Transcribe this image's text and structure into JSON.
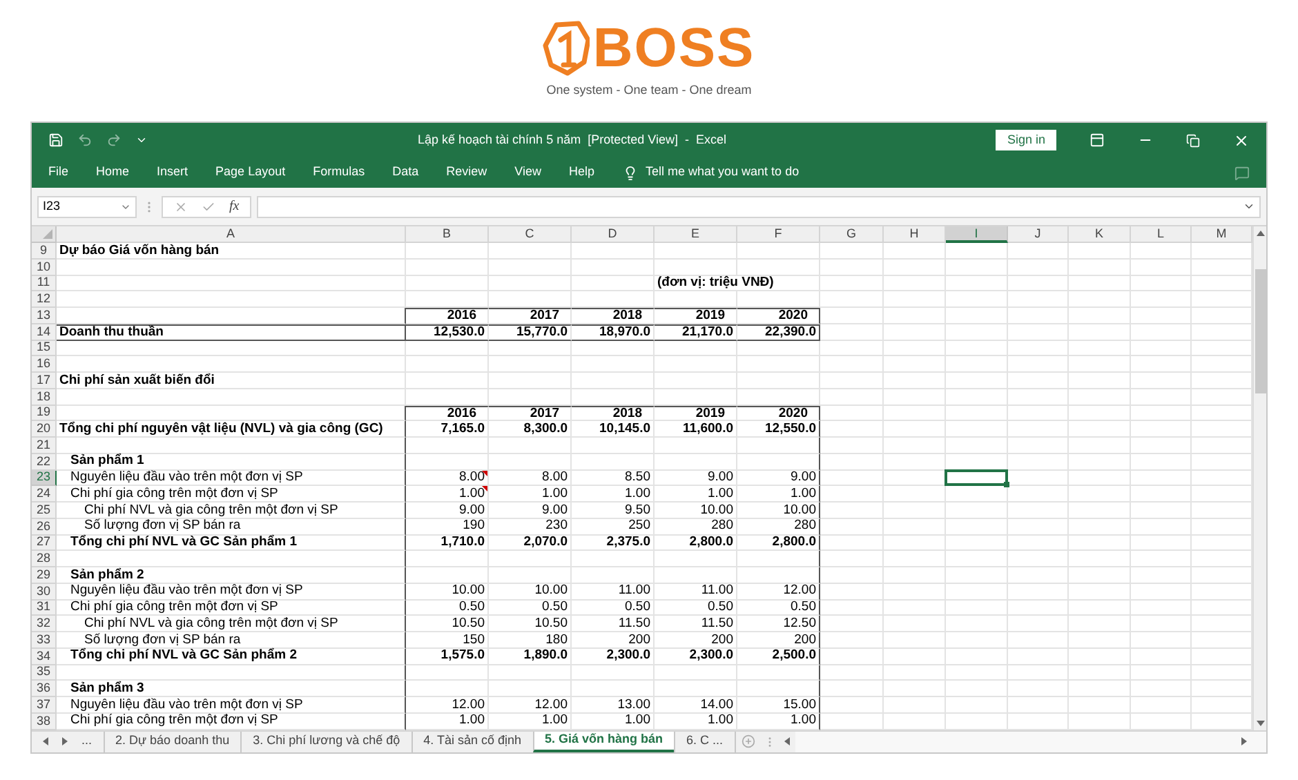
{
  "logo": {
    "brand": "BOSS",
    "tagline": "One system - One team - One dream"
  },
  "window": {
    "title": "Lập kế hoạch tài chính 5 năm  [Protected View]  -  Excel",
    "sign_in": "Sign in"
  },
  "ribbon_tabs": [
    "File",
    "Home",
    "Insert",
    "Page Layout",
    "Formulas",
    "Data",
    "Review",
    "View",
    "Help"
  ],
  "tell_me": "Tell me what you want to do",
  "formula_bar": {
    "name_box": "I23",
    "function_label": "fx"
  },
  "columns": [
    {
      "label": "A",
      "selected": false
    },
    {
      "label": "B",
      "selected": false
    },
    {
      "label": "C",
      "selected": false
    },
    {
      "label": "D",
      "selected": false
    },
    {
      "label": "E",
      "selected": false
    },
    {
      "label": "F",
      "selected": false
    },
    {
      "label": "G",
      "selected": false
    },
    {
      "label": "H",
      "selected": false
    },
    {
      "label": "I",
      "selected": true
    },
    {
      "label": "J",
      "selected": false
    },
    {
      "label": "K",
      "selected": false
    },
    {
      "label": "L",
      "selected": false
    },
    {
      "label": "M",
      "selected": false
    }
  ],
  "rows": [
    {
      "number": "9",
      "selected": false,
      "kind": "title",
      "boxed": false,
      "label": "Dự báo Giá vốn hàng bán"
    },
    {
      "number": "10",
      "selected": false,
      "kind": "blank",
      "boxed": false
    },
    {
      "number": "11",
      "selected": false,
      "kind": "note",
      "boxed": false,
      "note": "(đơn vị: triệu VNĐ)"
    },
    {
      "number": "12",
      "selected": false,
      "kind": "blank",
      "boxed": false
    },
    {
      "number": "13",
      "selected": false,
      "kind": "header",
      "boxed": true,
      "values": [
        "2016",
        "2017",
        "2018",
        "2019",
        "2020"
      ]
    },
    {
      "number": "14",
      "selected": false,
      "kind": "revenue",
      "boxed": true,
      "label": "Doanh thu thuần",
      "values": [
        "12,530.0",
        "15,770.0",
        "18,970.0",
        "21,170.0",
        "22,390.0"
      ]
    },
    {
      "number": "15",
      "selected": false,
      "kind": "blank",
      "boxed": false
    },
    {
      "number": "16",
      "selected": false,
      "kind": "blank",
      "boxed": false
    },
    {
      "number": "17",
      "selected": false,
      "kind": "title",
      "boxed": false,
      "label": "Chi phí sản xuất biến đổi"
    },
    {
      "number": "18",
      "selected": false,
      "kind": "blank",
      "boxed": false
    },
    {
      "number": "19",
      "selected": false,
      "kind": "header",
      "boxed": true,
      "values": [
        "2016",
        "2017",
        "2018",
        "2019",
        "2020"
      ]
    },
    {
      "number": "20",
      "selected": false,
      "kind": "total",
      "boxed": true,
      "label": "Tổng chi phí nguyên vật liệu (NVL) và gia công (GC)",
      "values": [
        "7,165.0",
        "8,300.0",
        "10,145.0",
        "11,600.0",
        "12,550.0"
      ]
    },
    {
      "number": "21",
      "selected": false,
      "kind": "blank",
      "boxed": true
    },
    {
      "number": "22",
      "selected": false,
      "kind": "section",
      "boxed": true,
      "label": "Sản phẩm 1"
    },
    {
      "number": "23",
      "selected": true,
      "kind": "item",
      "boxed": true,
      "comment": true,
      "label": "Nguyên liệu đầu vào trên một đơn vị SP",
      "values": [
        "8.00",
        "8.00",
        "8.50",
        "9.00",
        "9.00"
      ]
    },
    {
      "number": "24",
      "selected": false,
      "kind": "item",
      "boxed": true,
      "comment": true,
      "label": "Chi phí gia công trên một đơn vị SP",
      "values": [
        "1.00",
        "1.00",
        "1.00",
        "1.00",
        "1.00"
      ]
    },
    {
      "number": "25",
      "selected": false,
      "kind": "subitem",
      "boxed": true,
      "comment": false,
      "label": "Chi phí NVL và gia công trên một đơn vị SP",
      "values": [
        "9.00",
        "9.00",
        "9.50",
        "10.00",
        "10.00"
      ]
    },
    {
      "number": "26",
      "selected": false,
      "kind": "subitem",
      "boxed": true,
      "comment": false,
      "label": "Số lượng đơn vị SP bán ra",
      "values": [
        "190",
        "230",
        "250",
        "280",
        "280"
      ]
    },
    {
      "number": "27",
      "selected": false,
      "kind": "subtotal",
      "boxed": true,
      "label": "Tổng chi phí NVL và GC Sản phẩm 1",
      "values": [
        "1,710.0",
        "2,070.0",
        "2,375.0",
        "2,800.0",
        "2,800.0"
      ]
    },
    {
      "number": "28",
      "selected": false,
      "kind": "blank",
      "boxed": true
    },
    {
      "number": "29",
      "selected": false,
      "kind": "section",
      "boxed": true,
      "label": "Sản phẩm 2"
    },
    {
      "number": "30",
      "selected": false,
      "kind": "item",
      "boxed": true,
      "comment": false,
      "label": "Nguyên liệu đầu vào trên một đơn vị SP",
      "values": [
        "10.00",
        "10.00",
        "11.00",
        "11.00",
        "12.00"
      ]
    },
    {
      "number": "31",
      "selected": false,
      "kind": "item",
      "boxed": true,
      "comment": false,
      "label": "Chi phí gia công trên một đơn vị SP",
      "values": [
        "0.50",
        "0.50",
        "0.50",
        "0.50",
        "0.50"
      ]
    },
    {
      "number": "32",
      "selected": false,
      "kind": "subitem",
      "boxed": true,
      "comment": false,
      "label": "Chi phí NVL và gia công trên một đơn vị SP",
      "values": [
        "10.50",
        "10.50",
        "11.50",
        "11.50",
        "12.50"
      ]
    },
    {
      "number": "33",
      "selected": false,
      "kind": "subitem",
      "boxed": true,
      "comment": false,
      "label": "Số lượng đơn vị SP bán ra",
      "values": [
        "150",
        "180",
        "200",
        "200",
        "200"
      ]
    },
    {
      "number": "34",
      "selected": false,
      "kind": "subtotal",
      "boxed": true,
      "label": "Tổng chi phí NVL và GC Sản phẩm 2",
      "values": [
        "1,575.0",
        "1,890.0",
        "2,300.0",
        "2,300.0",
        "2,500.0"
      ]
    },
    {
      "number": "35",
      "selected": false,
      "kind": "blank",
      "boxed": true
    },
    {
      "number": "36",
      "selected": false,
      "kind": "section",
      "boxed": true,
      "label": "Sản phẩm 3"
    },
    {
      "number": "37",
      "selected": false,
      "kind": "item",
      "boxed": true,
      "comment": false,
      "label": "Nguyên liệu đầu vào trên một đơn vị SP",
      "values": [
        "12.00",
        "12.00",
        "13.00",
        "14.00",
        "15.00"
      ]
    },
    {
      "number": "38",
      "selected": false,
      "kind": "item",
      "boxed": true,
      "comment": false,
      "label": "Chi phí gia công trên một đơn vị SP",
      "values": [
        "1.00",
        "1.00",
        "1.00",
        "1.00",
        "1.00"
      ]
    }
  ],
  "sheet_nav": "...",
  "sheet_tabs": [
    {
      "label": "2. Dự báo doanh thu",
      "selected": false
    },
    {
      "label": "3. Chi phí lương và chế độ",
      "selected": false
    },
    {
      "label": "4. Tài sản cố định",
      "selected": false
    },
    {
      "label": "5. Giá vốn hàng bán",
      "selected": true
    },
    {
      "label": "6. C ...",
      "selected": false
    }
  ]
}
